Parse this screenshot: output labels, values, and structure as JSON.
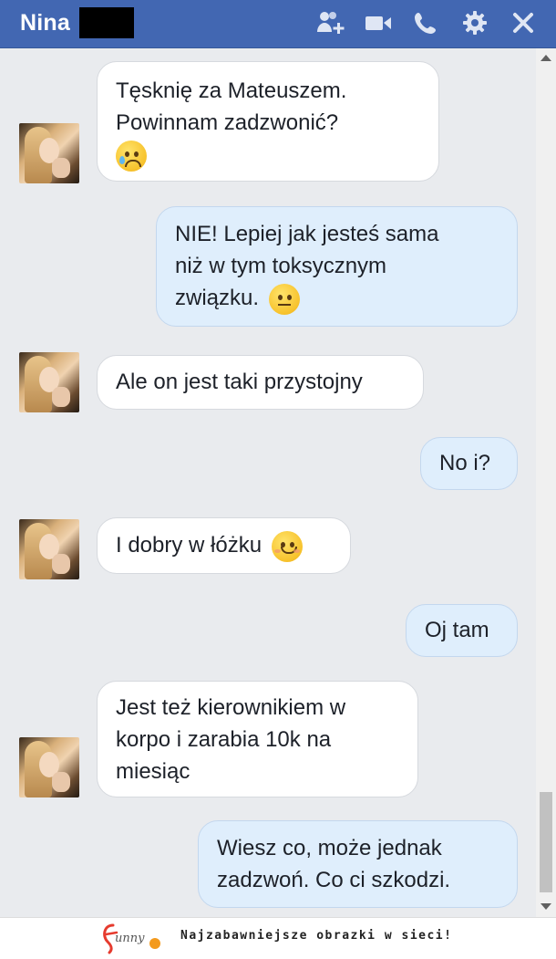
{
  "header": {
    "contact_name": "Nina",
    "icons": [
      "add-friend-icon",
      "video-call-icon",
      "phone-icon",
      "gear-icon",
      "close-icon"
    ],
    "bg_color": "#4267b2"
  },
  "messages": [
    {
      "side": "in",
      "lines": [
        "Tęsknię za Mateuszem.",
        "Powinnam zadzwonić?"
      ],
      "emoji": "crying-face-emoji"
    },
    {
      "side": "out",
      "lines": [
        "NIE! Lepiej jak jesteś sama",
        "niż w tym toksycznym",
        "związku."
      ],
      "emoji": "unamused-face-emoji"
    },
    {
      "side": "in",
      "lines": [
        "Ale on jest taki przystojny"
      ]
    },
    {
      "side": "out",
      "lines": [
        "No i?"
      ]
    },
    {
      "side": "in",
      "lines": [
        "I dobry w łóżku"
      ],
      "emoji": "smiling-blush-emoji"
    },
    {
      "side": "out",
      "lines": [
        "Oj tam"
      ]
    },
    {
      "side": "in",
      "lines": [
        "Jest też kierownikiem w",
        "korpo i zarabia 10k na",
        "miesiąc"
      ]
    },
    {
      "side": "out",
      "lines": [
        "Wiesz co, może jednak",
        "zadzwoń. Co ci szkodzi."
      ]
    }
  ],
  "footer": {
    "logo_text": "funny",
    "slogan": "Najzabawniejsze obrazki w sieci!"
  },
  "colors": {
    "incoming_bubble": "#ffffff",
    "outgoing_bubble": "#dfeefc",
    "chat_background": "#e9ebee"
  }
}
